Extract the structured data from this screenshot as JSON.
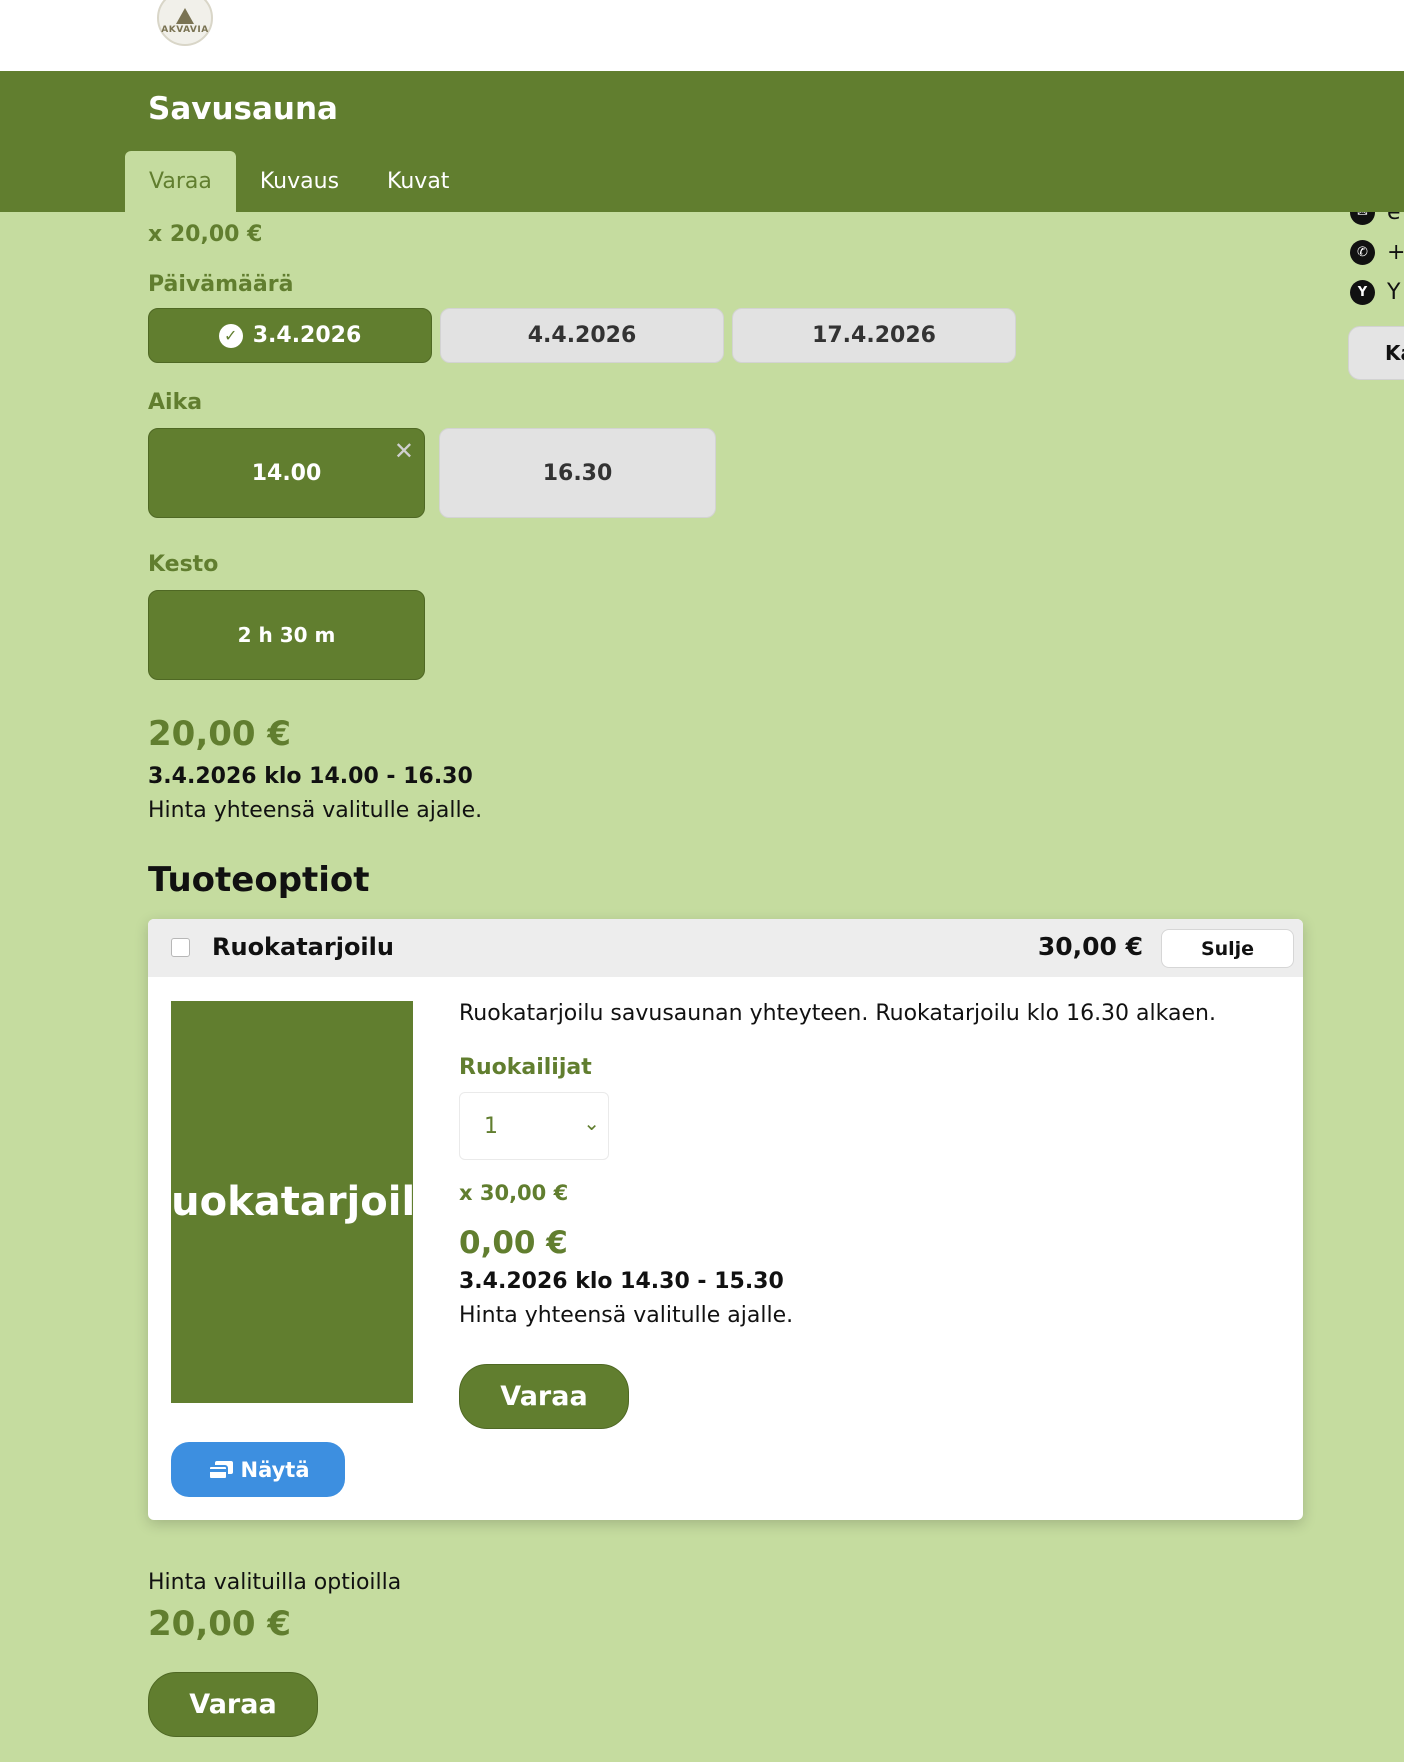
{
  "logo": {
    "text": "AKVAVIA"
  },
  "header": {
    "title": "Savusauna"
  },
  "tabs": [
    {
      "label": "Varaa",
      "active": true
    },
    {
      "label": "Kuvaus",
      "active": false
    },
    {
      "label": "Kuvat",
      "active": false
    }
  ],
  "sidebar": {
    "row1": "e",
    "row2": "+",
    "row3": "Y",
    "button": "Ka"
  },
  "booking": {
    "unit_price": "x 20,00 €",
    "date_label": "Päivämäärä",
    "dates": [
      "3.4.2026",
      "4.4.2026",
      "17.4.2026"
    ],
    "selected_date": "3.4.2026",
    "time_label": "Aika",
    "times": [
      "14.00",
      "16.30"
    ],
    "selected_time": "14.00",
    "duration_label": "Kesto",
    "duration": "2 h 30 m",
    "total": "20,00 €",
    "date_time": "3.4.2026 klo 14.00 - 16.30",
    "note": "Hinta yhteensä valitulle ajalle."
  },
  "options": {
    "title": "Tuoteoptiot",
    "card": {
      "name": "Ruokatarjoilu",
      "price": "30,00 €",
      "close_label": "Sulje",
      "image_text": "Ruokatarjoilu",
      "show_label": "Näytä",
      "description": "Ruokatarjoilu savusaunan yhteyteen. Ruokatarjoilu klo 16.30 alkaen.",
      "diners_label": "Ruokailijat",
      "diners_value": "1",
      "unit_price": "x 30,00 €",
      "total": "0,00 €",
      "date_time": "3.4.2026 klo 14.30 - 15.30",
      "note": "Hinta yhteensä valitulle ajalle.",
      "book_label": "Varaa"
    }
  },
  "summary": {
    "label": "Hinta valituilla optioilla",
    "total": "20,00 €",
    "book_label": "Varaa"
  },
  "colors": {
    "brand_green": "#617e2f",
    "background": "#c5dc9f",
    "info_blue": "#3d8fe0"
  }
}
